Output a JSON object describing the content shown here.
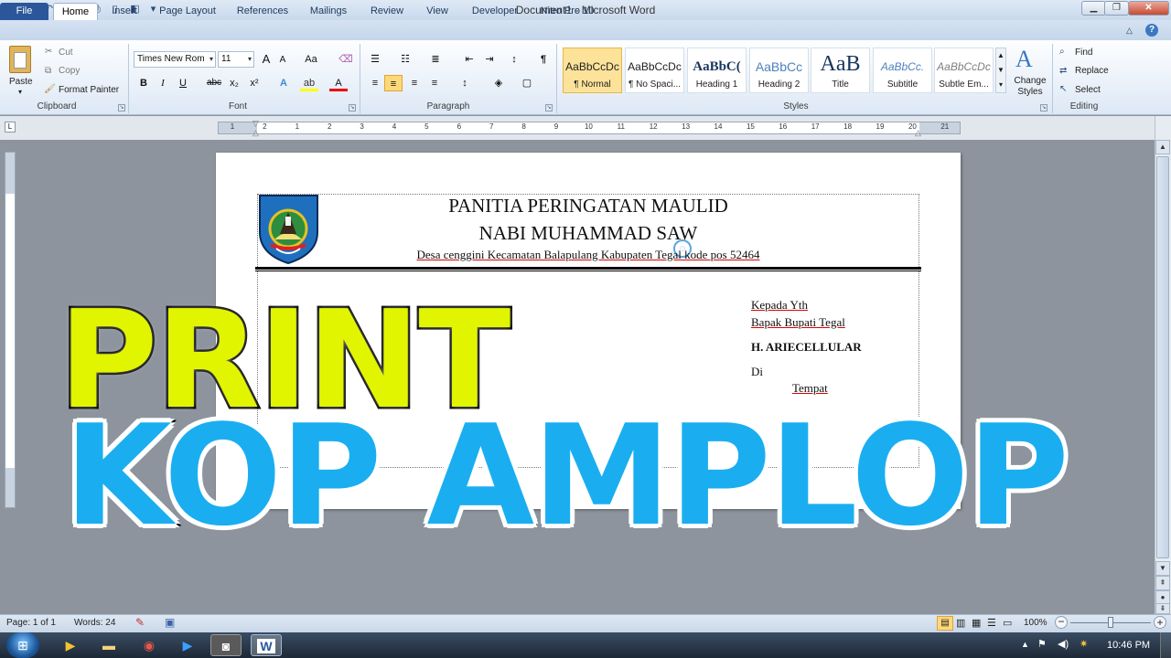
{
  "window": {
    "title": "Document1 - Microsoft Word",
    "min_icon": "minimize-icon",
    "max_icon": "maximize-icon",
    "close_label": "✕"
  },
  "tabs": [
    "File",
    "Home",
    "Insert",
    "Page Layout",
    "References",
    "Mailings",
    "Review",
    "View",
    "Developer",
    "Nitro Pro 10"
  ],
  "clipboard": {
    "paste": "Paste",
    "cut": "Cut",
    "copy": "Copy",
    "format_painter": "Format Painter",
    "group": "Clipboard"
  },
  "font": {
    "name": "Times New Rom",
    "size": "11",
    "group": "Font",
    "bold": "B",
    "italic": "I",
    "underline": "U",
    "strike": "abc",
    "sub": "x₂",
    "sup": "x²",
    "grow": "A",
    "shrink": "A",
    "case": "Aa"
  },
  "paragraph": {
    "group": "Paragraph",
    "pilcrow": "¶"
  },
  "styles": {
    "group": "Styles",
    "items": [
      {
        "sample": "AaBbCcDc",
        "name": "¶ Normal"
      },
      {
        "sample": "AaBbCcDc",
        "name": "¶ No Spaci..."
      },
      {
        "sample": "AaBbC(",
        "name": "Heading 1"
      },
      {
        "sample": "AaBbCc",
        "name": "Heading 2"
      },
      {
        "sample": "AaB",
        "name": "Title"
      },
      {
        "sample": "AaBbCc.",
        "name": "Subtitle"
      },
      {
        "sample": "AaBbCcDc",
        "name": "Subtle Em..."
      }
    ],
    "change_styles": "Change Styles"
  },
  "editing": {
    "find": "Find",
    "replace": "Replace",
    "select": "Select",
    "group": "Editing"
  },
  "ruler": {
    "numbers": [
      "1",
      "2",
      "1",
      "2",
      "3",
      "4",
      "5",
      "6",
      "7",
      "8",
      "9",
      "10",
      "11",
      "12",
      "13",
      "14",
      "15",
      "16",
      "17",
      "18",
      "19",
      "20",
      "21"
    ]
  },
  "document": {
    "header_line1": "PANITIA PERINGATAN MAULID",
    "header_line2": "NABI MUHAMMAD SAW",
    "address": "Desa cenggini Kecamatan Balapulang Kabupaten Tegal kode pos 52464",
    "kepada": "Kepada Yth",
    "bapak": "Bapak Bupati Tegal",
    "name": "H. ARIECELLULAR",
    "di": "Di",
    "tempat": "Tempat"
  },
  "overlay": {
    "line1": "PRINT",
    "line2": "KOP AMPLOP"
  },
  "colors": {
    "print_yellow": "#e1f500",
    "kop_blue": "#1aaef0",
    "file_tab": "#2b579a"
  },
  "status": {
    "page": "Page: 1 of 1",
    "words": "Words: 24",
    "zoom": "100%"
  },
  "taskbar": {
    "time": "10:46 PM"
  }
}
